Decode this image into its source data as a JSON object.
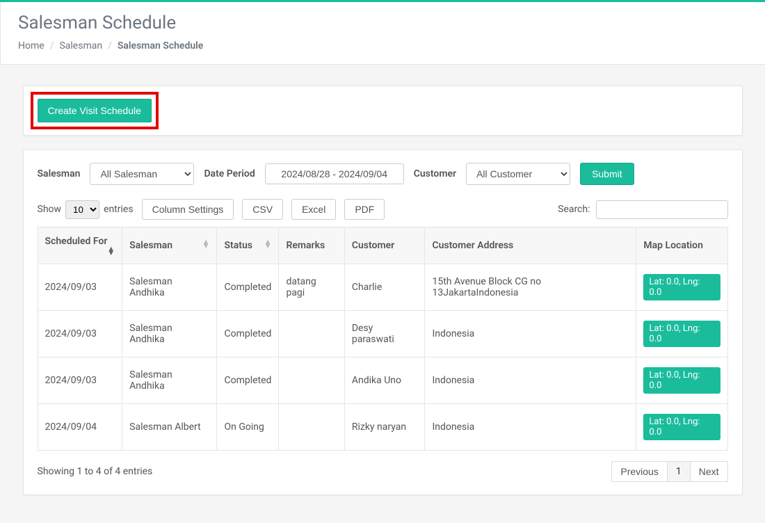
{
  "page": {
    "title": "Salesman Schedule"
  },
  "breadcrumb": {
    "items": [
      "Home",
      "Salesman",
      "Salesman Schedule"
    ]
  },
  "create_button": {
    "label": "Create Visit Schedule"
  },
  "filters": {
    "salesman_label": "Salesman",
    "salesman_value": "All Salesman",
    "date_label": "Date Period",
    "date_value": "2024/08/28 - 2024/09/04",
    "customer_label": "Customer",
    "customer_value": "All Customer",
    "submit_label": "Submit"
  },
  "controls": {
    "show_label": "Show",
    "entries_label": "entries",
    "page_size": "10",
    "column_settings": "Column Settings",
    "csv": "CSV",
    "excel": "Excel",
    "pdf": "PDF",
    "search_label": "Search:"
  },
  "table": {
    "headers": {
      "scheduled_for": "Scheduled For",
      "salesman": "Salesman",
      "status": "Status",
      "remarks": "Remarks",
      "customer": "Customer",
      "customer_address": "Customer Address",
      "map_location": "Map Location"
    },
    "rows": [
      {
        "scheduled_for": "2024/09/03",
        "salesman": "Salesman Andhika",
        "status": "Completed",
        "remarks": "datang pagi",
        "customer": "Charlie",
        "address": "15th Avenue Block CG no 13JakartaIndonesia",
        "map": "Lat: 0.0, Lng: 0.0"
      },
      {
        "scheduled_for": "2024/09/03",
        "salesman": "Salesman Andhika",
        "status": "Completed",
        "remarks": "",
        "customer": "Desy paraswati",
        "address": "Indonesia",
        "map": "Lat: 0.0, Lng: 0.0"
      },
      {
        "scheduled_for": "2024/09/03",
        "salesman": "Salesman Andhika",
        "status": "Completed",
        "remarks": "",
        "customer": "Andika Uno",
        "address": "Indonesia",
        "map": "Lat: 0.0, Lng: 0.0"
      },
      {
        "scheduled_for": "2024/09/04",
        "salesman": "Salesman Albert",
        "status": "On Going",
        "remarks": "",
        "customer": "Rizky naryan",
        "address": "Indonesia",
        "map": "Lat: 0.0, Lng: 0.0"
      }
    ]
  },
  "footer": {
    "info": "Showing 1 to 4 of 4 entries",
    "prev": "Previous",
    "page": "1",
    "next": "Next"
  }
}
